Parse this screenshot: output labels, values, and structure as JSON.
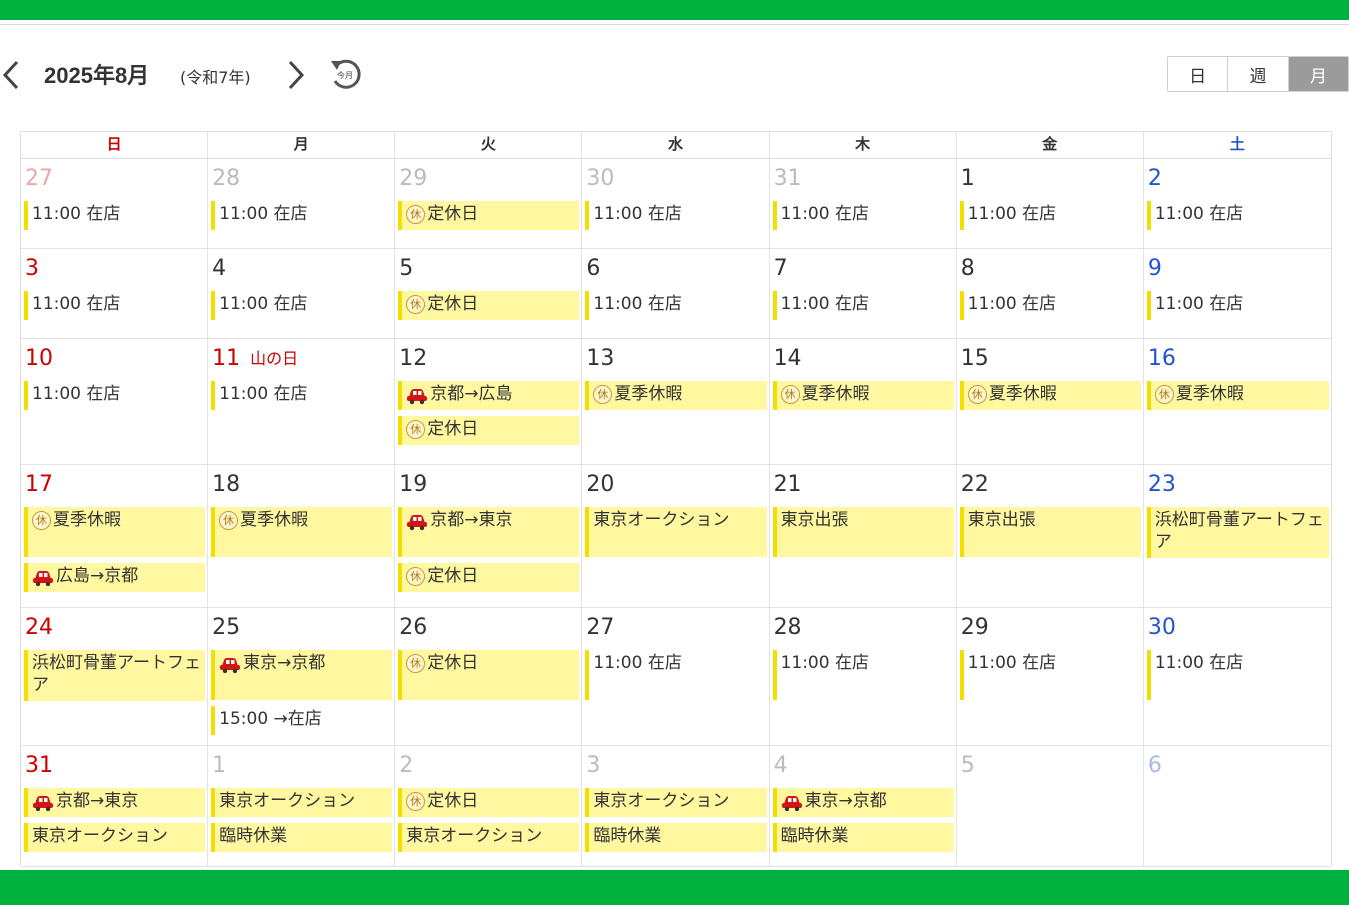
{
  "header": {
    "month_title": "2025年8月",
    "era": "(令和7年)",
    "today_icon_label": "今月"
  },
  "views": [
    "日",
    "週",
    "月"
  ],
  "active_view": "月",
  "weekdays": [
    "日",
    "月",
    "火",
    "水",
    "木",
    "金",
    "土"
  ],
  "icons": {
    "kyu": "休",
    "car": "car-icon"
  },
  "colors": {
    "brand": "#00b140",
    "event_bg": "#fff8a0",
    "event_border": "#f3de00",
    "sunday": "#cc0000",
    "saturday": "#2255cc"
  },
  "weeks": [
    [
      {
        "day": "27",
        "other": true,
        "events": [
          {
            "text": "11:00 在店"
          }
        ]
      },
      {
        "day": "28",
        "other": true,
        "events": [
          {
            "text": "11:00 在店"
          }
        ]
      },
      {
        "day": "29",
        "other": true,
        "events": [
          {
            "text": "定休日",
            "icon": "kyu",
            "bg": true
          }
        ]
      },
      {
        "day": "30",
        "other": true,
        "events": [
          {
            "text": "11:00 在店"
          }
        ]
      },
      {
        "day": "31",
        "other": true,
        "events": [
          {
            "text": "11:00 在店"
          }
        ]
      },
      {
        "day": "1",
        "events": [
          {
            "text": "11:00 在店"
          }
        ]
      },
      {
        "day": "2",
        "events": [
          {
            "text": "11:00 在店"
          }
        ]
      }
    ],
    [
      {
        "day": "3",
        "events": [
          {
            "text": "11:00 在店"
          }
        ]
      },
      {
        "day": "4",
        "events": [
          {
            "text": "11:00 在店"
          }
        ]
      },
      {
        "day": "5",
        "events": [
          {
            "text": "定休日",
            "icon": "kyu",
            "bg": true
          }
        ]
      },
      {
        "day": "6",
        "events": [
          {
            "text": "11:00 在店"
          }
        ]
      },
      {
        "day": "7",
        "events": [
          {
            "text": "11:00 在店"
          }
        ]
      },
      {
        "day": "8",
        "events": [
          {
            "text": "11:00 在店"
          }
        ]
      },
      {
        "day": "9",
        "events": [
          {
            "text": "11:00 在店"
          }
        ]
      }
    ],
    [
      {
        "day": "10",
        "events": [
          {
            "text": "11:00 在店"
          }
        ]
      },
      {
        "day": "11",
        "holiday": "山の日",
        "events": [
          {
            "text": "11:00 在店"
          }
        ]
      },
      {
        "day": "12",
        "events": [
          {
            "text": "京都→広島",
            "icon": "car",
            "bg": true
          },
          {
            "text": "定休日",
            "icon": "kyu",
            "bg": true
          }
        ]
      },
      {
        "day": "13",
        "events": [
          {
            "text": "夏季休暇",
            "icon": "kyu",
            "bg": true
          }
        ]
      },
      {
        "day": "14",
        "events": [
          {
            "text": "夏季休暇",
            "icon": "kyu",
            "bg": true
          }
        ]
      },
      {
        "day": "15",
        "events": [
          {
            "text": "夏季休暇",
            "icon": "kyu",
            "bg": true
          }
        ]
      },
      {
        "day": "16",
        "events": [
          {
            "text": "夏季休暇",
            "icon": "kyu",
            "bg": true
          }
        ]
      }
    ],
    [
      {
        "day": "17",
        "events": [
          {
            "text": "夏季休暇",
            "icon": "kyu",
            "bg": true,
            "tall": true
          },
          {
            "text": "広島→京都",
            "icon": "car",
            "bg": true
          }
        ]
      },
      {
        "day": "18",
        "events": [
          {
            "text": "夏季休暇",
            "icon": "kyu",
            "bg": true,
            "tall": true
          }
        ]
      },
      {
        "day": "19",
        "events": [
          {
            "text": "京都→東京",
            "icon": "car",
            "bg": true,
            "tall": true
          },
          {
            "text": "定休日",
            "icon": "kyu",
            "bg": true
          }
        ]
      },
      {
        "day": "20",
        "events": [
          {
            "text": "東京オークション",
            "bg": true,
            "tall": true
          }
        ]
      },
      {
        "day": "21",
        "events": [
          {
            "text": "東京出張",
            "bg": true,
            "tall": true
          }
        ]
      },
      {
        "day": "22",
        "events": [
          {
            "text": "東京出張",
            "bg": true,
            "tall": true
          }
        ]
      },
      {
        "day": "23",
        "events": [
          {
            "text": "浜松町骨董アートフェア",
            "bg": true,
            "tall": true
          }
        ]
      }
    ],
    [
      {
        "day": "24",
        "events": [
          {
            "text": "浜松町骨董アートフェア",
            "bg": true,
            "tall": true
          }
        ]
      },
      {
        "day": "25",
        "events": [
          {
            "text": "東京→京都",
            "icon": "car",
            "bg": true,
            "tall": true
          },
          {
            "text": "15:00 →在店"
          }
        ]
      },
      {
        "day": "26",
        "events": [
          {
            "text": "定休日",
            "icon": "kyu",
            "bg": true,
            "tall": true
          }
        ]
      },
      {
        "day": "27",
        "events": [
          {
            "text": "11:00 在店",
            "tall": true
          }
        ]
      },
      {
        "day": "28",
        "events": [
          {
            "text": "11:00 在店",
            "tall": true
          }
        ]
      },
      {
        "day": "29",
        "events": [
          {
            "text": "11:00 在店",
            "tall": true
          }
        ]
      },
      {
        "day": "30",
        "events": [
          {
            "text": "11:00 在店",
            "tall": true
          }
        ]
      }
    ],
    [
      {
        "day": "31",
        "events": [
          {
            "text": "京都→東京",
            "icon": "car",
            "bg": true
          },
          {
            "text": "東京オークション",
            "bg": true
          }
        ]
      },
      {
        "day": "1",
        "other": true,
        "events": [
          {
            "text": "東京オークション",
            "bg": true
          },
          {
            "text": "臨時休業",
            "bg": true
          }
        ]
      },
      {
        "day": "2",
        "other": true,
        "events": [
          {
            "text": "定休日",
            "icon": "kyu",
            "bg": true
          },
          {
            "text": "東京オークション",
            "bg": true
          }
        ]
      },
      {
        "day": "3",
        "other": true,
        "events": [
          {
            "text": "東京オークション",
            "bg": true
          },
          {
            "text": "臨時休業",
            "bg": true
          }
        ]
      },
      {
        "day": "4",
        "other": true,
        "events": [
          {
            "text": "東京→京都",
            "icon": "car",
            "bg": true
          },
          {
            "text": "臨時休業",
            "bg": true
          }
        ]
      },
      {
        "day": "5",
        "other": true,
        "events": []
      },
      {
        "day": "6",
        "other": true,
        "events": []
      }
    ]
  ]
}
